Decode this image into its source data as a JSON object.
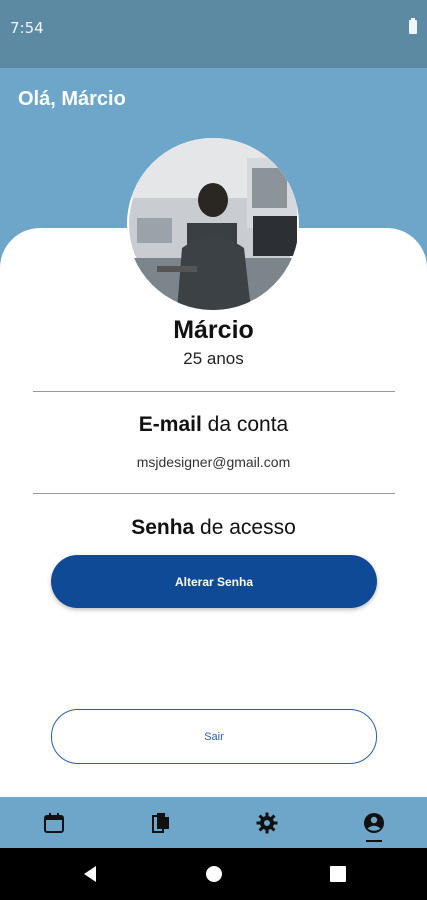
{
  "status_bar": {
    "time": "7:54"
  },
  "header": {
    "greeting": "Olá, Márcio"
  },
  "profile": {
    "name": "Márcio",
    "age": "25 anos"
  },
  "email_section": {
    "title_bold": "E-mail",
    "title_rest": " da conta",
    "email": "msjdesigner@gmail.com"
  },
  "password_section": {
    "title_bold": "Senha",
    "title_rest": " de acesso",
    "change_button": "Alterar Senha"
  },
  "logout_button": "Sair",
  "bottom_nav": {
    "items": [
      {
        "icon": "calendar-icon"
      },
      {
        "icon": "documents-icon"
      },
      {
        "icon": "settings-icon"
      },
      {
        "icon": "account-icon",
        "active": true
      }
    ]
  },
  "colors": {
    "header": "#6ea6c9",
    "status_bar": "#5d8aa3",
    "primary_button": "#0e4a96",
    "outline": "#2a5ea8"
  }
}
